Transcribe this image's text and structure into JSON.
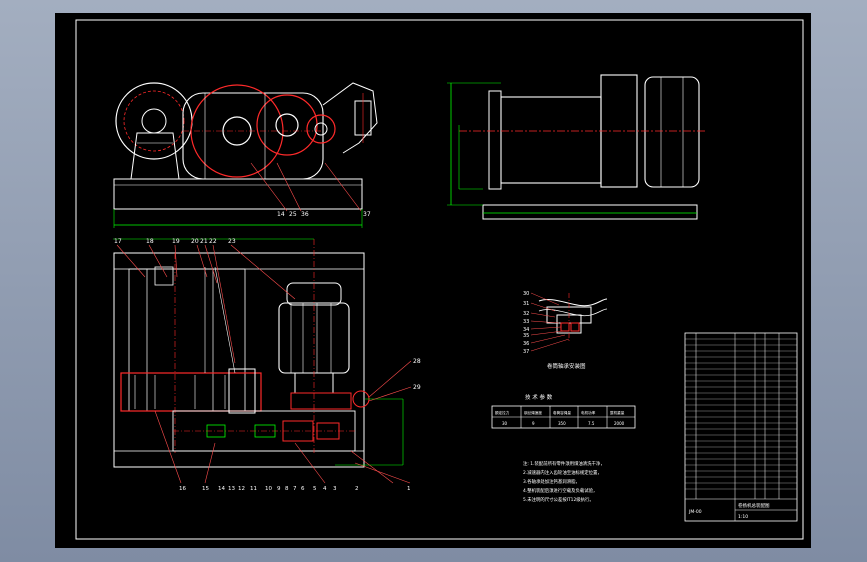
{
  "callouts_front": [
    "14",
    "25",
    "36",
    "37"
  ],
  "callouts_plan_top": [
    "17",
    "18",
    "19",
    "20",
    "21",
    "22",
    "23"
  ],
  "callouts_plan_right": [
    "28",
    "29"
  ],
  "callouts_plan_bottom": [
    "16",
    "15",
    "14",
    "13",
    "12",
    "11",
    "10",
    "9",
    "8",
    "7",
    "6",
    "5",
    "4",
    "3",
    "2",
    "1"
  ],
  "callouts_detail": [
    "30",
    "31",
    "32",
    "33",
    "34",
    "35",
    "36",
    "37"
  ],
  "detail_caption": "卷筒轴承安装图",
  "tech_table": {
    "title": "技 术 参 数",
    "headers": [
      "额定拉力",
      "钢丝绳速度",
      "卷筒容绳量",
      "电机功率",
      "整机重量"
    ],
    "values": [
      "30",
      "9",
      "350",
      "7.5",
      "2000"
    ]
  },
  "notes": [
    "注: 1.装配前所有零件须用煤油清洗干净，",
    "    2.减速器内注入齿轮油至油标规定位置，",
    "    3.各轴承处加注钙基润滑脂，",
    "    4.整机装配后须进行空载及负载试验，",
    "    5.未注明的尺寸公差按IT12级执行。"
  ],
  "title_block": {
    "name": "卷扬机总装配图",
    "drawing_no": "JM-00",
    "scale": "1:10"
  },
  "colors": {
    "background": "#000000",
    "outline": "#ffffff",
    "section": "#ff2a2a",
    "centerline": "#ff2a2a",
    "dimension": "#00ff00",
    "leader": "#ff4d4d",
    "callout_text": "#ffffff"
  }
}
